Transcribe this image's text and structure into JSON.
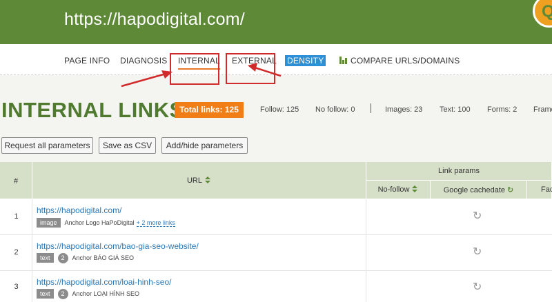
{
  "header": {
    "url": "https://hapodigital.com/",
    "logo_letter": "Q"
  },
  "nav": {
    "page_info": "PAGE INFO",
    "diagnosis": "DIAGNOSIS",
    "internal": "INTERNAL",
    "external": "EXTERNAL",
    "density": "DENSITY",
    "compare": "COMPARE URLS/DOMAINS"
  },
  "summary": {
    "title": "INTERNAL LINKS",
    "total_links": "Total links:  125",
    "follow": "Follow:  125",
    "no_follow": "No follow:  0",
    "images": "Images:  23",
    "text": "Text:  100",
    "forms": "Forms:  2",
    "frames": "Frame"
  },
  "buttons": {
    "request_all": "Request all parameters",
    "save_csv": "Save as CSV",
    "add_hide": "Add/hide parameters"
  },
  "table": {
    "col_num": "#",
    "col_url": "URL",
    "group_link_params": "Link params",
    "col_nofollow": "No-follow",
    "col_cachedate": "Google cachedate",
    "col_fac": "Fac",
    "rows": [
      {
        "num": "1",
        "url": "https://hapodigital.com/",
        "tag": "image",
        "count": "",
        "anchor": "Anchor Logo HaPoDigital",
        "more": "+ 2 more links"
      },
      {
        "num": "2",
        "url": "https://hapodigital.com/bao-gia-seo-website/",
        "tag": "text",
        "count": "2",
        "anchor": "Anchor BÁO GIÁ SEO",
        "more": ""
      },
      {
        "num": "3",
        "url": "https://hapodigital.com/loai-hinh-seo/",
        "tag": "text",
        "count": "2",
        "anchor": "Anchor LOẠI HÌNH SEO",
        "more": ""
      }
    ]
  },
  "colors": {
    "header_green": "#5e8a38",
    "accent_orange": "#f07d16",
    "density_blue": "#2d8fd6",
    "annotation_red": "#d12a2a"
  }
}
